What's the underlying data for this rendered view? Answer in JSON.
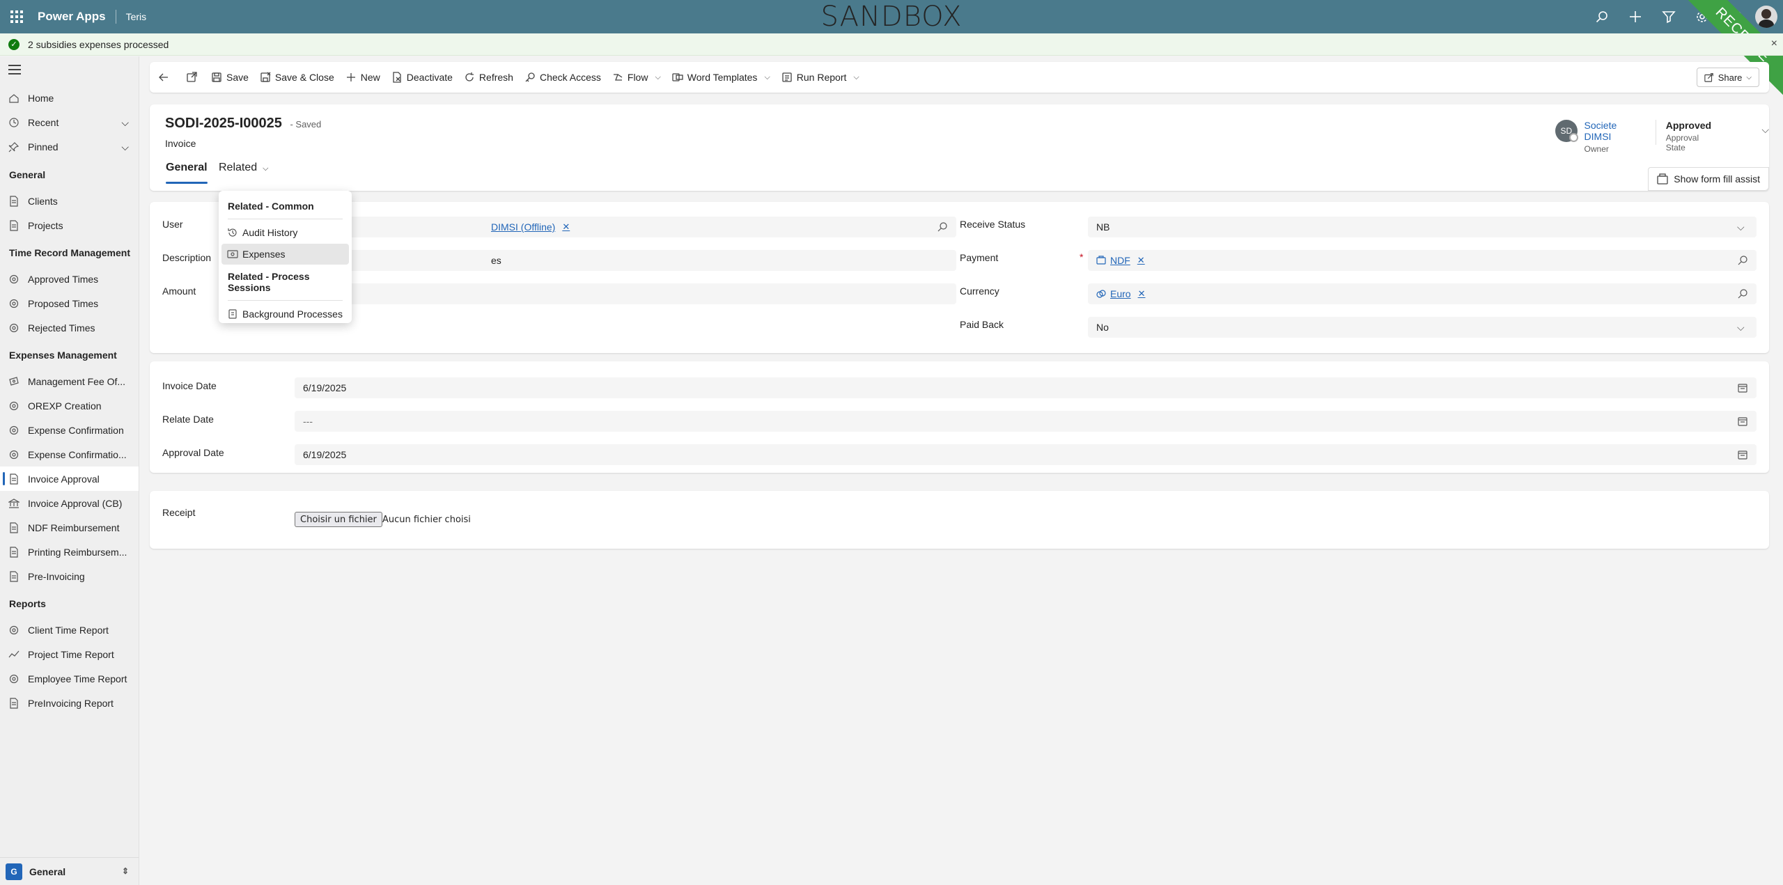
{
  "topbar": {
    "app_name": "Power Apps",
    "env_name": "Teris",
    "banner": "SANDBOX",
    "ribbon": "RECETTE"
  },
  "notification": {
    "message": "2 subsidies expenses processed",
    "close": "×"
  },
  "sidebar": {
    "top_items": [
      {
        "label": "Home",
        "icon": "home-icon"
      },
      {
        "label": "Recent",
        "icon": "clock-icon"
      },
      {
        "label": "Pinned",
        "icon": "pin-icon"
      }
    ],
    "groups": [
      {
        "title": "General",
        "items": [
          {
            "label": "Clients",
            "icon": "document-icon"
          },
          {
            "label": "Projects",
            "icon": "document-icon"
          }
        ]
      },
      {
        "title": "Time Record Management",
        "items": [
          {
            "label": "Approved Times",
            "icon": "gear-doc-icon"
          },
          {
            "label": "Proposed Times",
            "icon": "gear-doc-icon"
          },
          {
            "label": "Rejected Times",
            "icon": "gear-doc-icon"
          }
        ]
      },
      {
        "title": "Expenses Management",
        "items": [
          {
            "label": "Management Fee Of...",
            "icon": "money-icon"
          },
          {
            "label": "OREXP Creation",
            "icon": "gear-doc-icon"
          },
          {
            "label": "Expense Confirmation",
            "icon": "gear-doc-icon"
          },
          {
            "label": "Expense Confirmatio...",
            "icon": "gear-doc-icon"
          },
          {
            "label": "Invoice Approval",
            "icon": "document-icon"
          },
          {
            "label": "Invoice Approval (CB)",
            "icon": "bank-icon"
          },
          {
            "label": "NDF Reimbursement",
            "icon": "document-icon"
          },
          {
            "label": "Printing Reimbursem...",
            "icon": "document-icon"
          },
          {
            "label": "Pre-Invoicing",
            "icon": "document-icon"
          }
        ]
      },
      {
        "title": "Reports",
        "items": [
          {
            "label": "Client Time Report",
            "icon": "gear-doc-icon"
          },
          {
            "label": "Project Time Report",
            "icon": "chart-line-icon"
          },
          {
            "label": "Employee Time Report",
            "icon": "gear-doc-icon"
          },
          {
            "label": "PreInvoicing Report",
            "icon": "document-icon"
          }
        ]
      }
    ],
    "area": {
      "badge": "G",
      "label": "General"
    }
  },
  "commandbar": {
    "save": "Save",
    "save_close": "Save & Close",
    "new": "New",
    "deactivate": "Deactivate",
    "refresh": "Refresh",
    "check_access": "Check Access",
    "flow": "Flow",
    "word_templates": "Word Templates",
    "run_report": "Run Report",
    "share": "Share"
  },
  "header": {
    "title": "SODI-2025-I00025",
    "saved": "- Saved",
    "entity": "Invoice",
    "owner_initials": "SD",
    "owner_name": "Societe DIMSI",
    "owner_label": "Owner",
    "approval_value": "Approved",
    "approval_label": "Approval State",
    "tabs": {
      "general": "General",
      "related": "Related"
    },
    "fill_assist": "Show form fill assist"
  },
  "form": {
    "user_label": "User",
    "user_value": "DIMSI (Offline)",
    "description_label": "Description",
    "description_value": "es",
    "amount_label": "Amount",
    "receive_status_label": "Receive Status",
    "receive_status_value": "NB",
    "payment_label": "Payment",
    "payment_value": "NDF",
    "currency_label": "Currency",
    "currency_value": "Euro",
    "paid_back_label": "Paid Back",
    "paid_back_value": "No",
    "required_mark": "*",
    "invoice_date_label": "Invoice Date",
    "invoice_date_value": "6/19/2025",
    "relate_date_label": "Relate Date",
    "relate_date_value": "---",
    "approval_date_label": "Approval Date",
    "approval_date_value": "6/19/2025",
    "receipt_label": "Receipt",
    "file_button": "Choisir un fichier",
    "file_none": "Aucun fichier choisi"
  },
  "related_menu": {
    "common_header": "Related - Common",
    "audit_history": "Audit History",
    "expenses": "Expenses",
    "process_header": "Related - Process Sessions",
    "background_processes": "Background Processes"
  }
}
